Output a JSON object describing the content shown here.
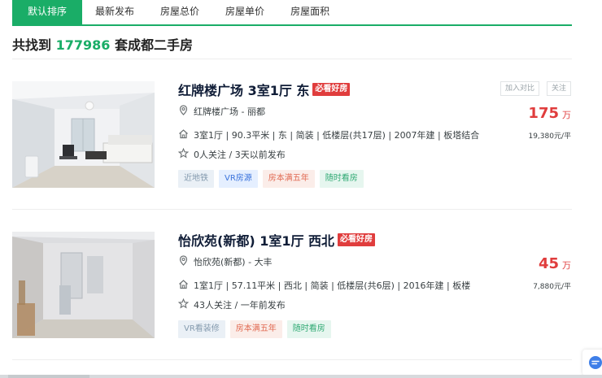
{
  "sort_tabs": [
    {
      "label": "默认排序",
      "active": true
    },
    {
      "label": "最新发布",
      "active": false
    },
    {
      "label": "房屋总价",
      "active": false
    },
    {
      "label": "房屋单价",
      "active": false
    },
    {
      "label": "房屋面积",
      "active": false
    }
  ],
  "summary": {
    "prefix": "共找到",
    "count": "177986",
    "suffix": "套成都二手房"
  },
  "listings": [
    {
      "title": "红牌楼广场 3室1厅 东",
      "badge": "必看好房",
      "community": "红牌楼广场",
      "separator": " - ",
      "district": "丽都",
      "info": "3室1厅 | 90.3平米 | 东 | 简装 | 低楼层(共17层) | 2007年建 | 板塔结合",
      "follow": "0人关注 / 3天以前发布",
      "tags": [
        "近地铁",
        "VR房源",
        "房本满五年",
        "随时看房"
      ],
      "price": "175",
      "price_unit": "万",
      "unit_price": "19,380元/平",
      "compare_label": "加入对比",
      "follow_label": "关注"
    },
    {
      "title": "怡欣苑(新都) 1室1厅 西北",
      "badge": "必看好房",
      "community": "怡欣苑(新都)",
      "separator": " - ",
      "district": "大丰",
      "info": "1室1厅 | 57.11平米 | 西北 | 简装 | 低楼层(共6层) | 2016年建 | 板楼",
      "follow": "43人关注 / 一年前发布",
      "tags": [
        "VR看装修",
        "房本满五年",
        "随时看房"
      ],
      "price": "45",
      "price_unit": "万",
      "unit_price": "7,880元/平"
    }
  ],
  "colors": {
    "accent": "#1aad67",
    "price": "#e03d3d",
    "badge": "#e03d3d"
  },
  "icons": [
    "location-pin-icon",
    "house-icon",
    "star-icon",
    "chat-icon"
  ]
}
